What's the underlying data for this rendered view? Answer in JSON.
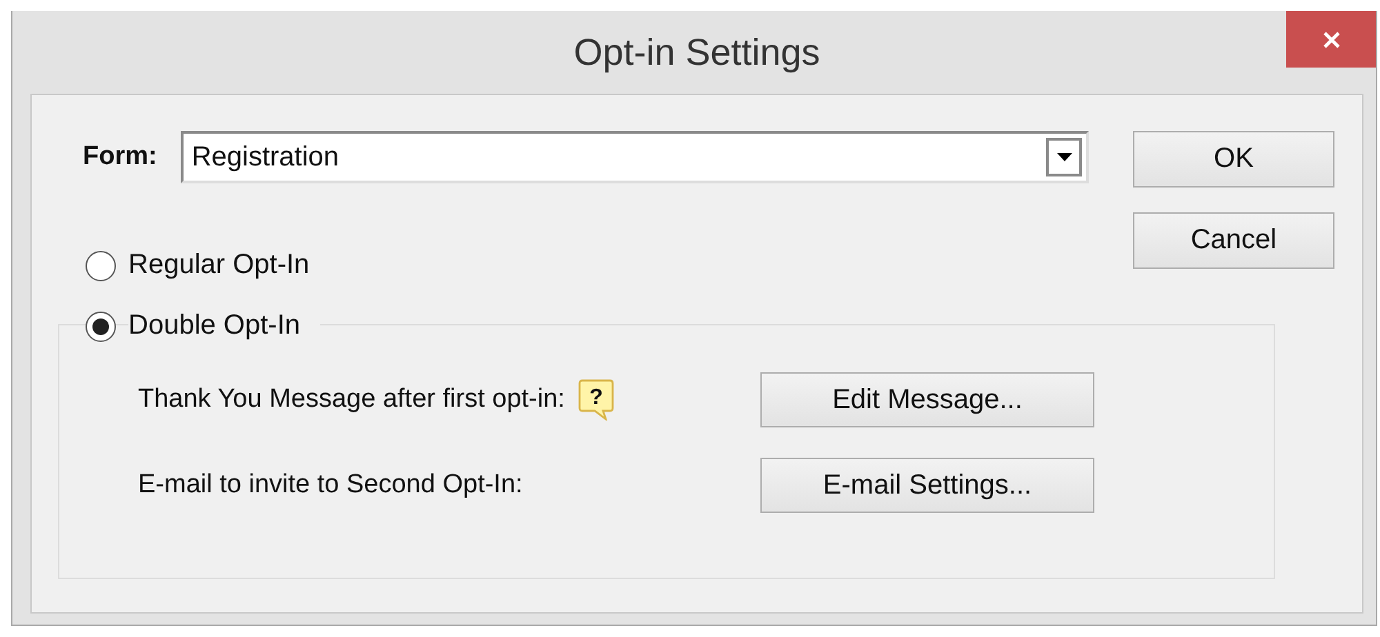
{
  "window": {
    "title": "Opt-in Settings"
  },
  "form_field": {
    "label": "Form:",
    "value": "Registration"
  },
  "buttons": [
    {
      "label": "OK"
    },
    {
      "label": "Cancel"
    }
  ],
  "options": [
    {
      "label": "Regular Opt-In",
      "selected": false
    },
    {
      "label": "Double Opt-In",
      "selected": true
    }
  ],
  "double_opt_in_rows": [
    {
      "label": "Thank You Message after first opt-in:",
      "help_icon": "?",
      "button": "Edit Message..."
    },
    {
      "label": "E-mail to invite to Second Opt-In:",
      "button": "E-mail Settings..."
    }
  ]
}
